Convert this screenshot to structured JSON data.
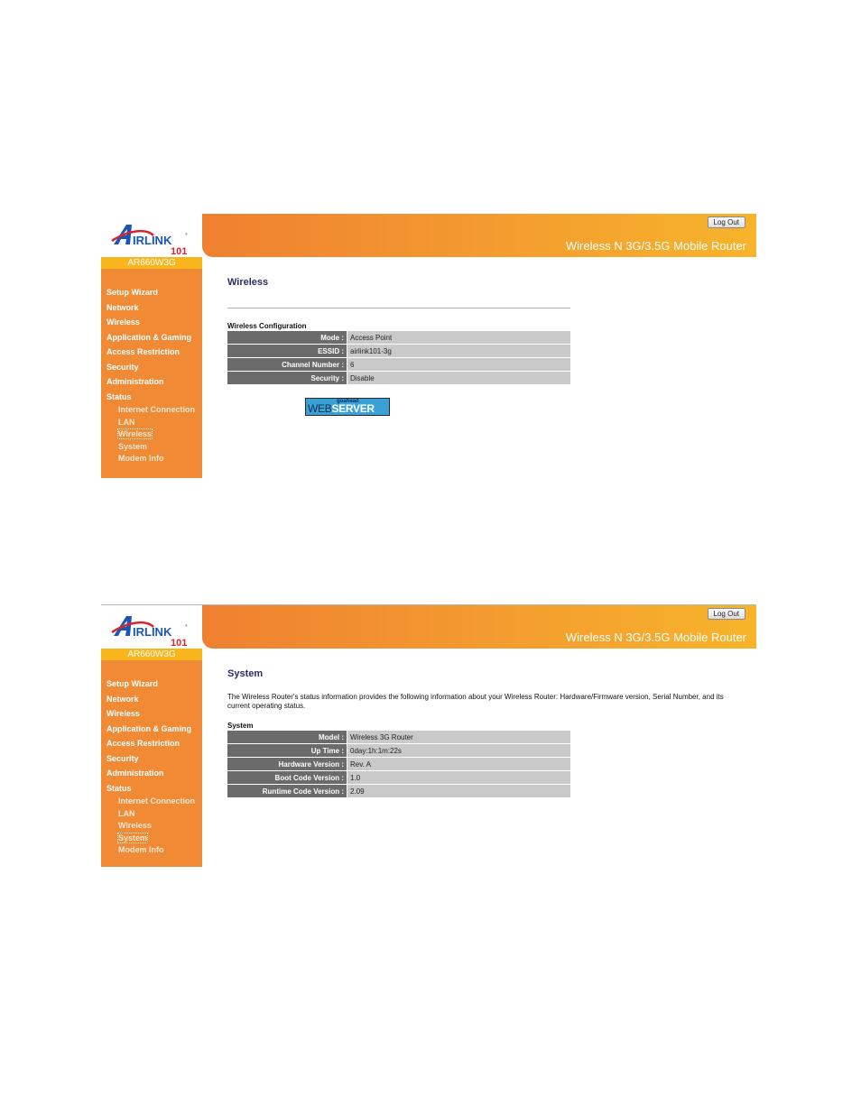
{
  "app": {
    "brand": "AIRLINK 101",
    "model": "AR660W3G",
    "product_title": "Wireless N 3G/3.5G Mobile Router",
    "logout_label": "Log Out",
    "colors": {
      "sidebar": "#f08a34",
      "model_bar": "#fbb51c",
      "title": "#2d2d66",
      "key_cell": "#6b6b6b",
      "value_cell": "#c9c9c9"
    }
  },
  "nav": {
    "items": [
      "Setup Wizard",
      "Network",
      "Wireless",
      "Application & Gaming",
      "Access Restriction",
      "Security",
      "Administration",
      "Status"
    ],
    "status_sub": [
      "Internet Connection",
      "LAN",
      "Wireless",
      "System",
      "Modem Info"
    ]
  },
  "wireless_page": {
    "title": "Wireless",
    "active_sub": "Wireless",
    "section": "Wireless Configuration",
    "rows": [
      {
        "label": "Mode :",
        "value": "Access Point"
      },
      {
        "label": "ESSID :",
        "value": "airlink101-3g"
      },
      {
        "label": "Channel Number :",
        "value": "6"
      },
      {
        "label": "Security :",
        "value": "Disable"
      }
    ],
    "badge": {
      "top": "goahead",
      "web": "WEB",
      "server": "SERVER"
    }
  },
  "system_page": {
    "title": "System",
    "active_sub": "System",
    "description": "The Wireless Router's status information provides the following information about your Wireless Router: Hardware/Firmware version, Serial Number, and its current operating status.",
    "section": "System",
    "rows": [
      {
        "label": "Model :",
        "value": "Wireless 3G Router"
      },
      {
        "label": "Up Time :",
        "value": "0day:1h:1m:22s"
      },
      {
        "label": "Hardware Version :",
        "value": "Rev. A"
      },
      {
        "label": "Boot Code Version :",
        "value": "1.0"
      },
      {
        "label": "Runtime Code Version :",
        "value": "2.09"
      }
    ]
  }
}
